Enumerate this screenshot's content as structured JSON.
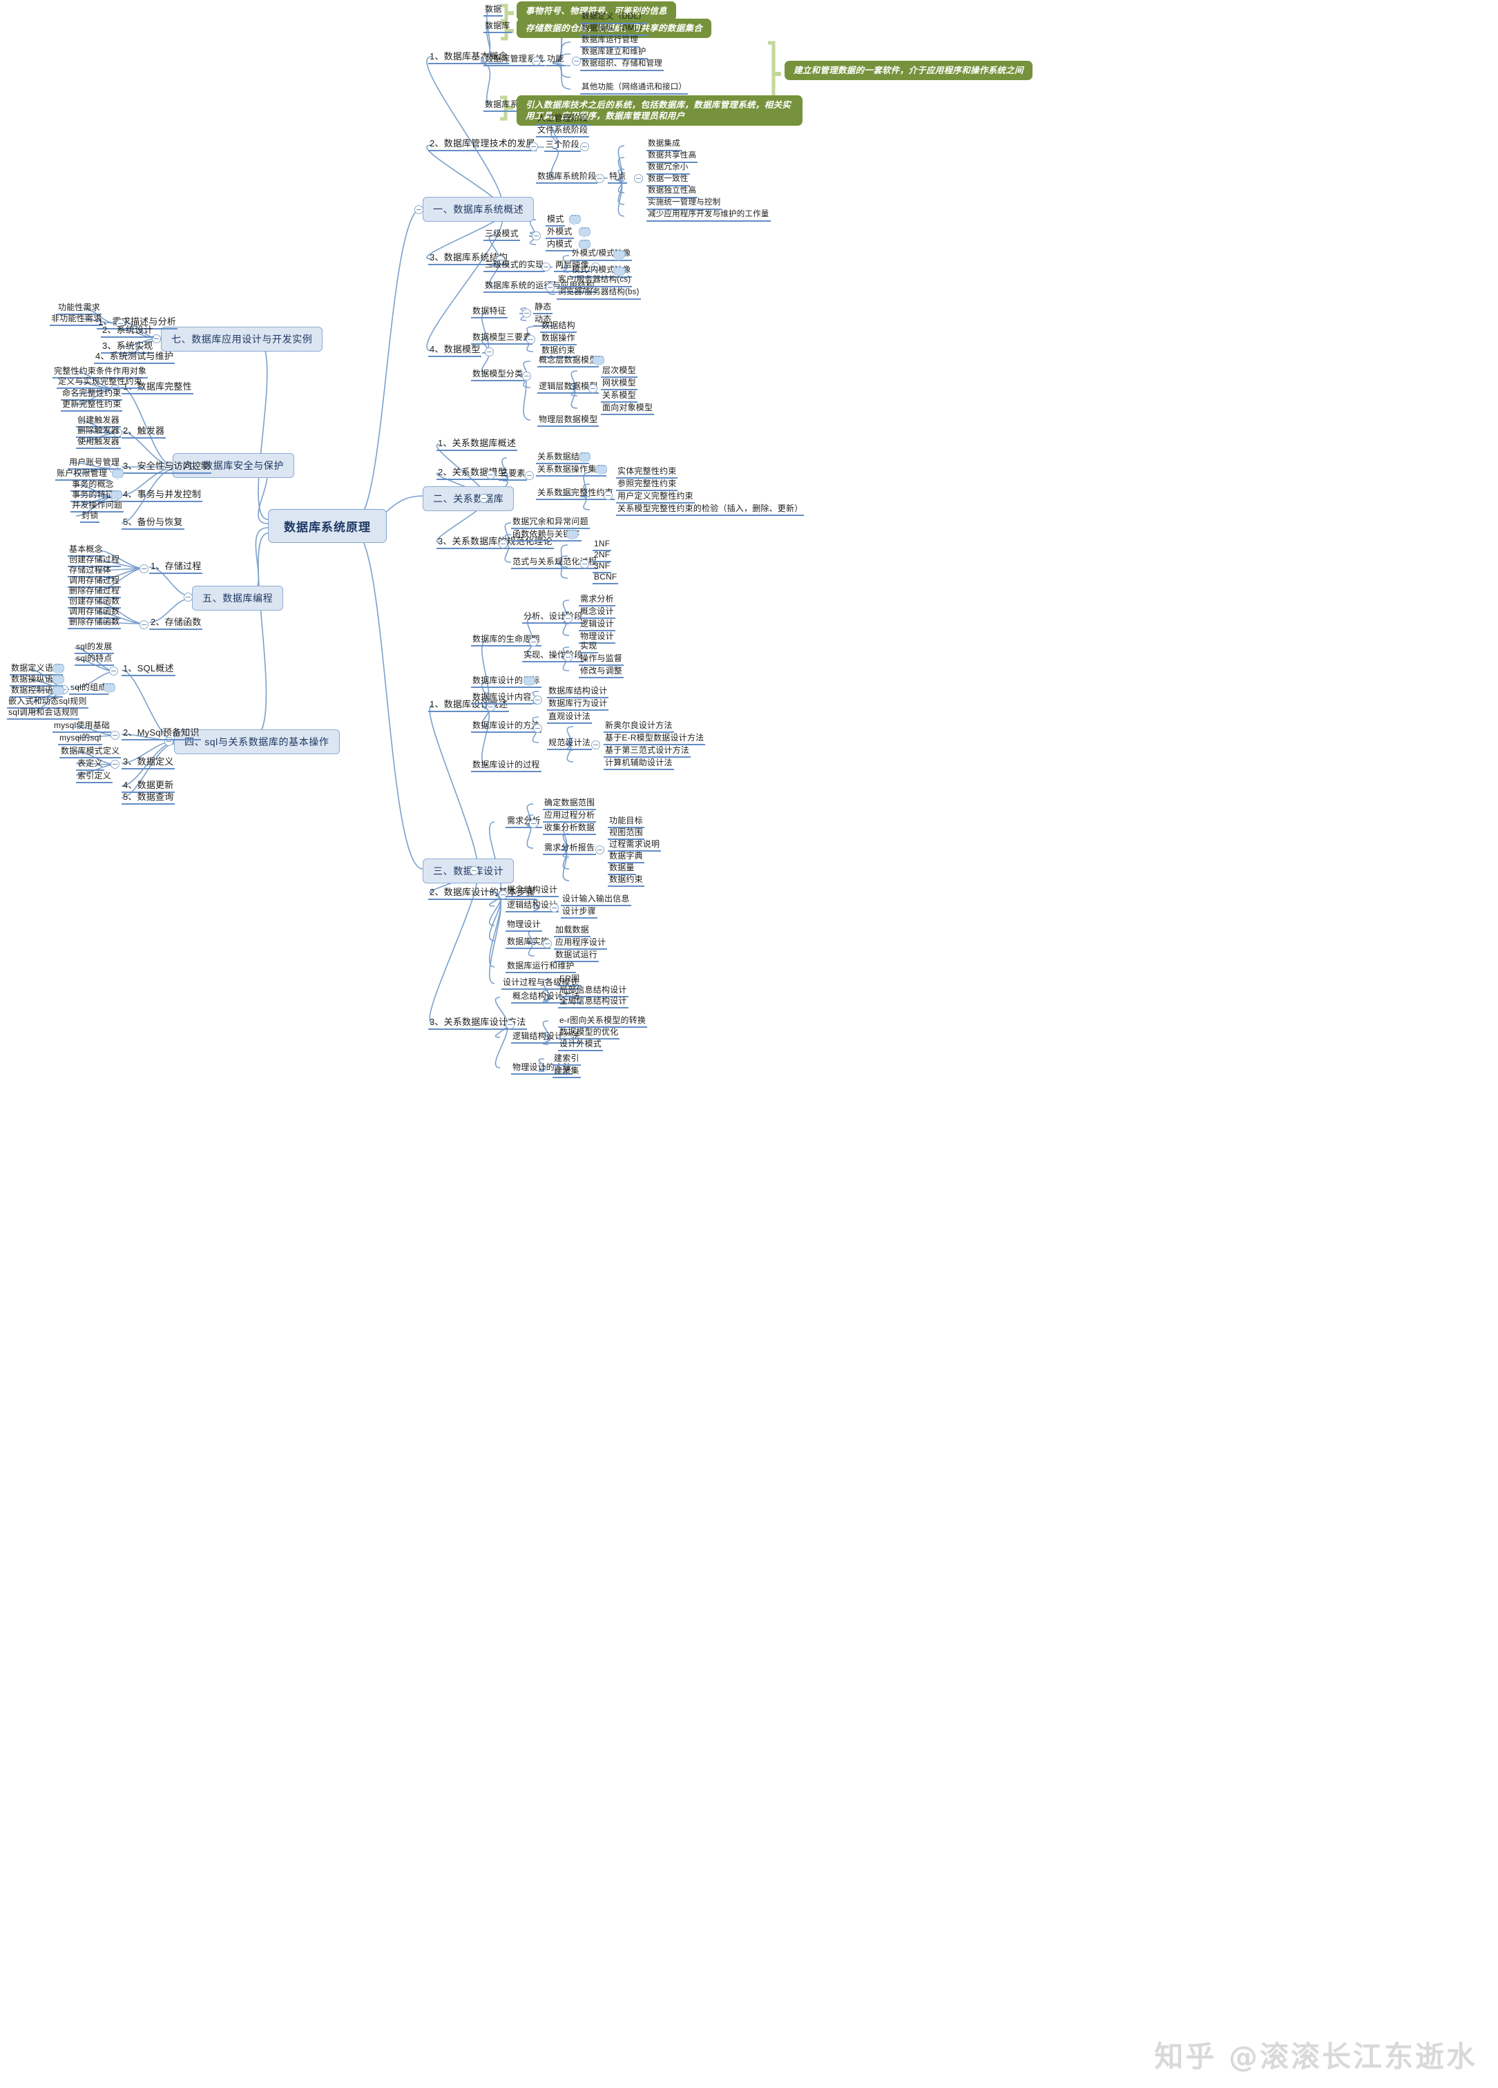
{
  "root": {
    "label": "数据库系统原理"
  },
  "watermark": "知乎 @滚滚长江东逝水",
  "branches": {
    "b1": {
      "label": "一、数据库系统概述",
      "s1": {
        "label": "1、数据库基本概念",
        "n_data": "数据",
        "note_data": "事物符号、物理符号、可鉴别的信息",
        "n_db": "数据库",
        "note_db": "存储数据的仓库，有组织，可共享的数据集合",
        "n_dbms": "数据库管理系统",
        "n_func": "功能",
        "func_items": [
          "数据定义（DDL）",
          "数据操纵（DML）",
          "数据库运行管理",
          "数据库建立和维护",
          "数据组织、存储和管理",
          "其他功能（网络通讯和接口）"
        ],
        "note_dbms": "建立和管理数据的一套软件，介于应用程序和操作系统之间",
        "n_dbsys": "数据库系统",
        "note_dbsys": "引入数据库技术之后的系统，包括数据库，数据库管理系统，相关实用工具，应用程序，数据库管理员和用户"
      },
      "s2": {
        "label": "2、数据库管理技术的发展",
        "n_stages": "三个阶段",
        "stages": [
          "人工管理阶段",
          "文件系统阶段"
        ],
        "n_dbstage": "数据库系统阶段",
        "n_feat": "特点",
        "feats": [
          "数据集成",
          "数据共享性高",
          "数据冗余小",
          "数据一致性",
          "数据独立性高",
          "实施统一管理与控制",
          "减少应用程序开发与维护的工作量"
        ]
      },
      "s3": {
        "label": "3、数据库系统结构",
        "n_three": "三级模式",
        "three": [
          "模式",
          "外模式",
          "内模式"
        ],
        "n_impl": "三级模式的实现",
        "n_two": "两层映像",
        "two": [
          "外模式/模式映像",
          "模式/内模式映像"
        ],
        "n_run": "数据库系统的运行与应用结构",
        "run": [
          "客户/服务器结构(cs)",
          "浏览器/服务器结构(bs)"
        ]
      },
      "s4": {
        "label": "4、数据模型",
        "n_char": "数据特征",
        "chars": [
          "静态",
          "动态"
        ],
        "n_three_ele": "数据模型三要素",
        "three_ele": [
          "数据结构",
          "数据操作",
          "数据约束"
        ],
        "n_class": "数据模型分类",
        "n_concept": "概念层数据模型",
        "n_logic": "逻辑层数据模型",
        "logic": [
          "层次模型",
          "网状模型",
          "关系模型",
          "面向对象模型"
        ],
        "n_phys": "物理层数据模型"
      }
    },
    "b2": {
      "label": "二、关系数据库",
      "s1": {
        "label": "1、关系数据库概述"
      },
      "s2": {
        "label": "2、关系数据模型",
        "n_three": "三要素",
        "n_struct": "关系数据结构",
        "n_ops": "关系数据操作集合",
        "n_integ": "关系数据完整性约束",
        "integ": [
          "实体完整性约束",
          "参照完整性约束",
          "用户定义完整性约束",
          "关系模型完整性约束的检验（插入，删除、更新）"
        ]
      },
      "s3": {
        "label": "3、关系数据库的规范化理论",
        "items": [
          "数据冗余和异常问题",
          "函数依赖与关键字"
        ],
        "n_nf": "范式与关系规范化过程",
        "nf": [
          "1NF",
          "2NF",
          "3NF",
          "BCNF"
        ]
      }
    },
    "b3": {
      "label": "三、数据库设计",
      "s1": {
        "label": "1、数据库设计概述",
        "n_life": "数据库的生命周期",
        "n_analysis": "分析、设计阶段",
        "analysis": [
          "需求分析",
          "概念设计",
          "逻辑设计",
          "物理设计"
        ],
        "n_impl": "实现、操作阶段",
        "impl": [
          "实现",
          "操作与监督",
          "修改与调整"
        ],
        "n_goal": "数据库设计的目标",
        "n_content": "数据库设计内容",
        "content": [
          "数据库结构设计",
          "数据库行为设计"
        ],
        "n_method": "数据库设计的方法",
        "n_intuitive": "直观设计法",
        "n_norm": "规范设计法",
        "norm": [
          "新奥尔良设计方法",
          "基于E-R模型数据设计方法",
          "基于第三范式设计方法",
          "计算机辅助设计法"
        ],
        "n_process": "数据库设计的过程"
      },
      "s2": {
        "label": "2、数据库设计的基本步骤",
        "n_req": "需求分析",
        "req": [
          "确定数据范围",
          "应用过程分析",
          "收集分析数据"
        ],
        "n_report": "需求分析报告",
        "report": [
          "功能目标",
          "视图范围",
          "过程需求说明",
          "数据字典",
          "数据量",
          "数据约束"
        ],
        "n_concept": "概念结构设计",
        "n_logic": "逻辑结构设计",
        "logic": [
          "设计输入输出信息",
          "设计步骤"
        ],
        "n_phys": "物理设计",
        "n_deploy": "数据库实施",
        "deploy": [
          "加载数据",
          "应用程序设计",
          "数据试运行"
        ],
        "n_run": "数据库运行和维护",
        "n_mode": "设计过程与各级模式"
      },
      "s3": {
        "label": "3、关系数据库设计方法",
        "n_concept_m": "概念结构设计方法",
        "concept_m": [
          "ER图",
          "局部信息结构设计",
          "全局信息结构设计"
        ],
        "n_logic_m": "逻辑结构设计方法",
        "logic_m": [
          "e-r图向关系模型的转换",
          "数据模型的优化",
          "设计外模式"
        ],
        "n_phys_m": "物理设计的方法",
        "phys_m": [
          "建索引",
          "建聚集"
        ]
      }
    },
    "b4": {
      "label": "四、sql与关系数据库的基本操作",
      "s1": {
        "label": "1、SQL概述",
        "items": [
          "sql的发展",
          "sql的特点"
        ],
        "n_comp": "sql的组成",
        "comp": [
          "数据定义语言",
          "数据操纵语言",
          "数据控制语言",
          "嵌入式和动态sql规则",
          "sql调用和会话规则"
        ]
      },
      "s2": {
        "label": "2、MySql预备知识",
        "items": [
          "mysql使用基础",
          "mysql的sql"
        ]
      },
      "s3": {
        "label": "3、数据定义",
        "items": [
          "数据库模式定义",
          "表定义",
          "索引定义"
        ]
      },
      "s4": {
        "label": "4、数据更新"
      },
      "s5": {
        "label": "5、数据查询"
      }
    },
    "b5": {
      "label": "五、数据库编程",
      "s1": {
        "label": "1、存储过程",
        "items": [
          "基本概念",
          "创建存储过程",
          "存储过程体",
          "调用存储过程",
          "删除存储过程"
        ]
      },
      "s2": {
        "label": "2、存储函数",
        "items": [
          "创建存储函数",
          "调用存储函数",
          "删除存储函数"
        ]
      }
    },
    "b6": {
      "label": "六、数据库安全与保护",
      "s1": {
        "label": "1、数据库完整性",
        "items": [
          "完整性约束条件作用对象",
          "定义与实现完整性约束",
          "命名完整性约束",
          "更新完整性约束"
        ]
      },
      "s2": {
        "label": "2、触发器",
        "items": [
          "创建触发器",
          "删除触发器",
          "使用触发器"
        ]
      },
      "s3": {
        "label": "3、安全性与访问控制",
        "items": [
          "用户账号管理",
          "账户权限管理"
        ]
      },
      "s4": {
        "label": "4、事务与并发控制",
        "items": [
          "事务的概念",
          "事务的特征",
          "并发操作问题",
          "封锁"
        ]
      },
      "s5": {
        "label": "5、备份与恢复"
      }
    },
    "b7": {
      "label": "七、数据库应用设计与开发实例",
      "s1": {
        "label": "1、需求描述与分析",
        "items": [
          "功能性需求",
          "非功能性需求"
        ]
      },
      "s2": {
        "label": "2、系统设计"
      },
      "s3": {
        "label": "3、系统实现"
      },
      "s4": {
        "label": "4、系统测试与维护"
      }
    }
  }
}
